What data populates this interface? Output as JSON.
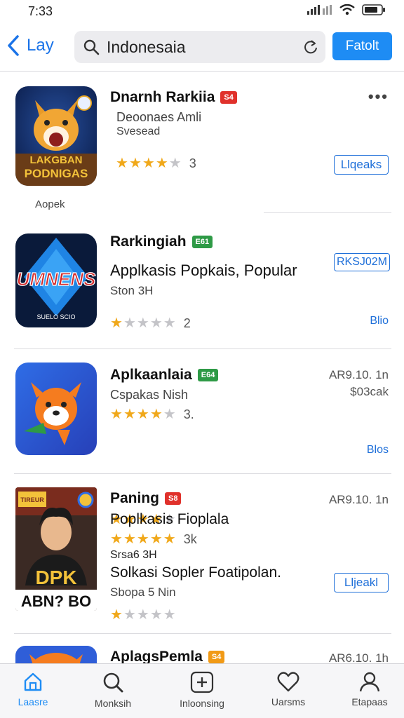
{
  "status": {
    "time": "7:33"
  },
  "nav": {
    "back_label": "Lay",
    "search_query": "Indonesaia",
    "action_label": "Fatolt"
  },
  "apps": [
    {
      "title": "Dnarnh Rarkiia",
      "badge": "S4",
      "subtitle1": "Deoonaes Amli",
      "subtitle2": "Svesead",
      "rating": 4,
      "rating_count": "3",
      "button": "Llqeaks",
      "more": "•••",
      "caption": "Aopek",
      "icon_text": [
        "LAKGBAN",
        "PODNIGAS"
      ]
    },
    {
      "title": "Rarkingiah",
      "badge": "E61",
      "subtitle1": "Applkasis Popkais, Popular",
      "subtitle2": "Ston 3H",
      "rating": 1,
      "rating_count": "2",
      "price": "RKSJ02M",
      "link": "Blio",
      "icon_text": [
        "UMNENS",
        "SUELO SCIO"
      ]
    },
    {
      "title": "Aplkaanlaia",
      "badge": "E64",
      "subtitle1": "Cspakas Nish",
      "rating_a": 4,
      "rating_a_count": "3.",
      "rating_b": 4,
      "price": "AR9.10. 1n",
      "price_sub": "$03cak",
      "link": "Blos"
    },
    {
      "title": "Paning",
      "badge": "S8",
      "subtitle1": "Poplkasis Fioplala",
      "rating_a": 4,
      "rating_a_count": "3k",
      "subtitle2": "Srsa6 3H",
      "subtitle3": "Solkasi Sopler Foatipolan.",
      "subtitle4": "Sbopa 5 Nin",
      "rating_b": 1,
      "price": "AR9.10. 1n",
      "button": "Lljeakl",
      "icon_text": [
        "TIREUR",
        "DPK",
        "ABN? BO"
      ]
    },
    {
      "title": "AplagsPemla",
      "badge": "S4",
      "price": "AR6.10. 1h"
    }
  ],
  "tabs": [
    {
      "label": "Laasre",
      "icon": "home-icon"
    },
    {
      "label": "Monksih",
      "icon": "search-icon"
    },
    {
      "label": "Inloonsing",
      "icon": "add-icon"
    },
    {
      "label": "Uarsms",
      "icon": "heart-icon"
    },
    {
      "label": "Etapaas",
      "icon": "person-icon"
    }
  ],
  "colors": {
    "accent": "#1e8cf4",
    "star": "#f0a81a"
  }
}
